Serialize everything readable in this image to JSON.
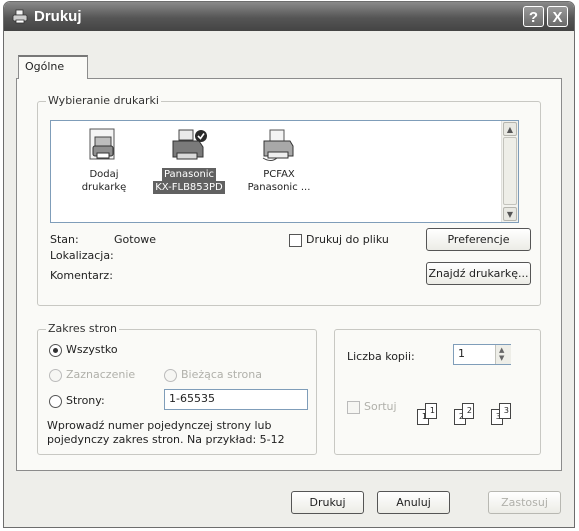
{
  "window": {
    "title": "Drukuj"
  },
  "title_buttons": {
    "help": "?",
    "close": "X"
  },
  "tabs": [
    {
      "label": "Ogólne"
    }
  ],
  "printer_select": {
    "group_label": "Wybieranie drukarki",
    "printers": [
      {
        "line1": "Dodaj",
        "line2": "drukarkę",
        "icon": "add-printer-icon",
        "selected": false
      },
      {
        "line1": "Panasonic",
        "line2": "KX-FLB853PD",
        "icon": "default-printer-icon",
        "selected": true
      },
      {
        "line1": "PCFAX",
        "line2": "Panasonic ...",
        "icon": "printer-icon",
        "selected": false
      }
    ],
    "status_label": "Stan:",
    "status_value": "Gotowe",
    "location_label": "Lokalizacja:",
    "location_value": "",
    "comment_label": "Komentarz:",
    "comment_value": "",
    "print_to_file_label": "Drukuj do pliku",
    "print_to_file_checked": false,
    "preferences_button": "Preferencje",
    "find_printer_button": "Znajdź drukarkę..."
  },
  "page_range": {
    "group_label": "Zakres stron",
    "all_label": "Wszystko",
    "all_selected": true,
    "selection_label": "Zaznaczenie",
    "current_page_label": "Bieżąca strona",
    "pages_label": "Strony:",
    "pages_value": "1-65535",
    "hint_line1": "Wprowadź numer pojedynczej strony lub",
    "hint_line2": "pojedynczy zakres stron. Na przykład: 5-12"
  },
  "copies": {
    "count_label": "Liczba kopii:",
    "count_value": "1",
    "collate_label": "Sortuj",
    "collate_checked": false,
    "collate_pages": [
      "1",
      "1",
      "2",
      "2",
      "3",
      "3"
    ]
  },
  "buttons": {
    "print": "Drukuj",
    "cancel": "Anuluj",
    "apply": "Zastosuj"
  }
}
